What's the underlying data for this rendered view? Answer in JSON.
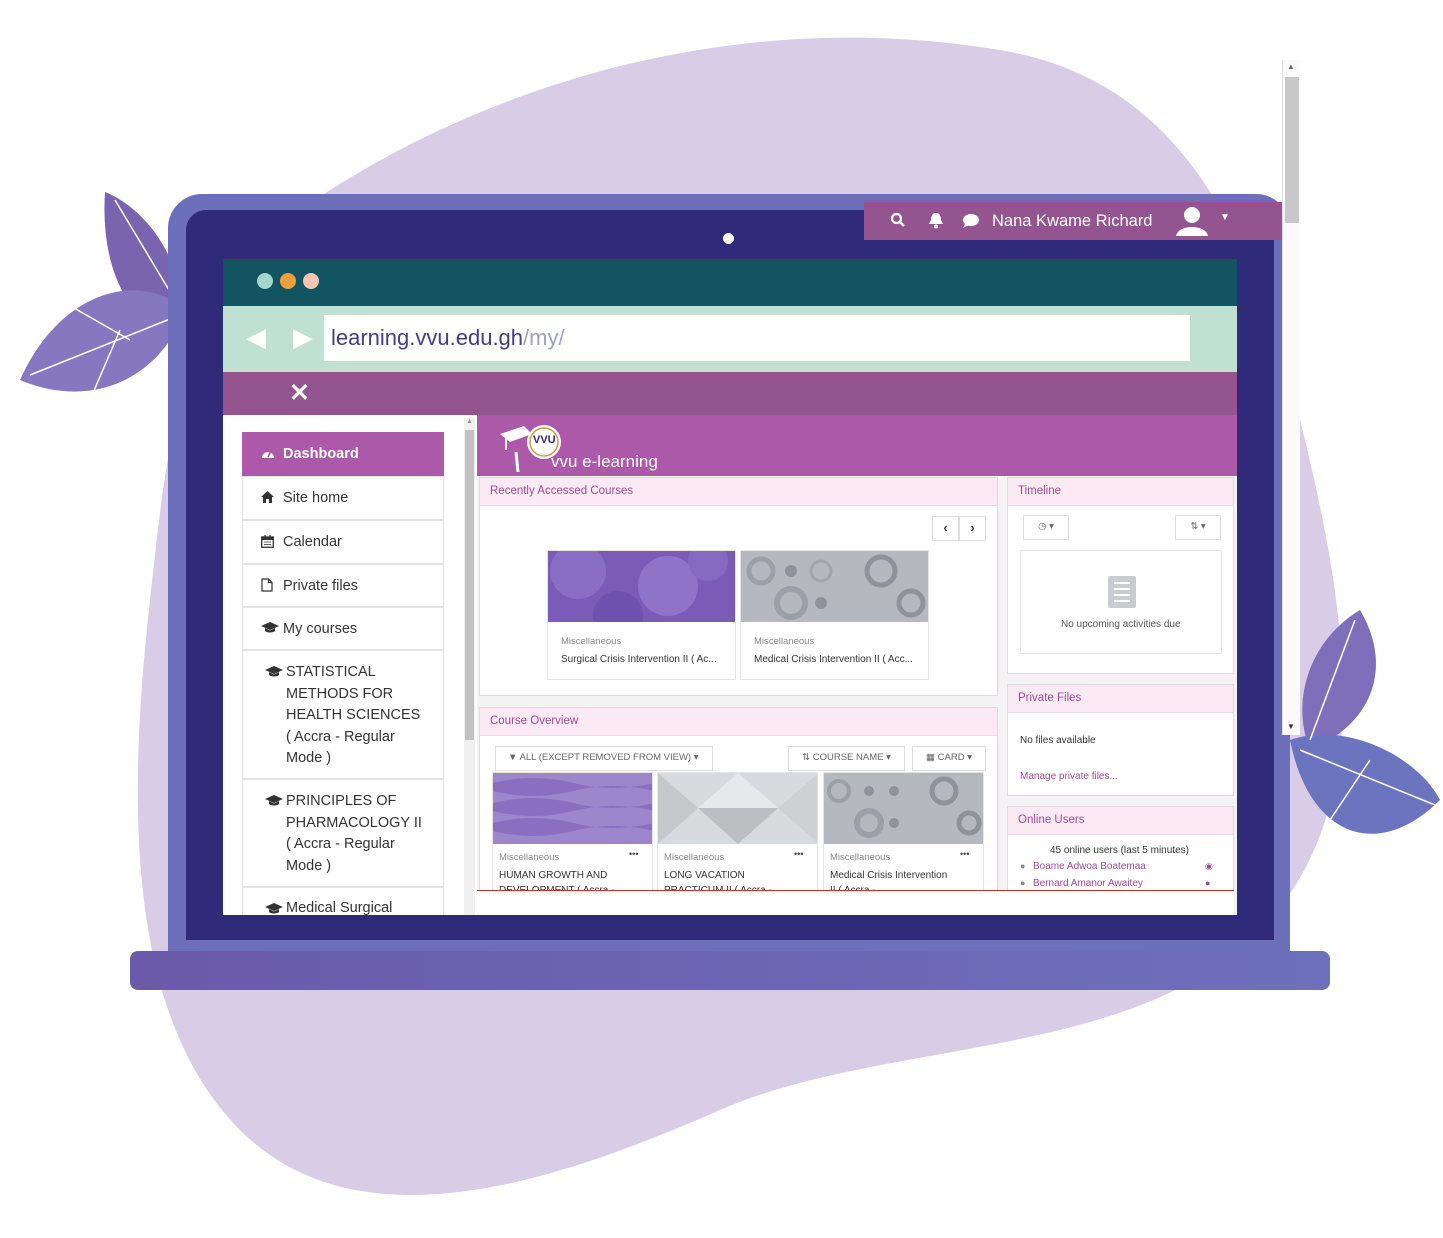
{
  "colors": {
    "blob": "#d9cce6",
    "laptop": "#6e6fbb",
    "bezel": "#2f2a7a",
    "teal": "#125561",
    "mint": "#bfe0d3",
    "plum": "#93548f",
    "accent": "#ab59a8"
  },
  "browser": {
    "url_host": "learning.vvu.edu.gh",
    "url_path": "/my/",
    "back_icon": "chevron-left-icon",
    "forward_icon": "chevron-right-icon",
    "close_icon": "close-icon"
  },
  "userbar": {
    "user_name": "Nana Kwame Richard",
    "icons": [
      "search-icon",
      "bell-icon",
      "chat-icon",
      "user-avatar-icon",
      "caret-down-icon"
    ]
  },
  "sidebar": {
    "items": [
      {
        "label": "Dashboard",
        "icon": "dashboard-icon",
        "active": true
      },
      {
        "label": "Site home",
        "icon": "home-icon"
      },
      {
        "label": "Calendar",
        "icon": "calendar-icon"
      },
      {
        "label": "Private files",
        "icon": "file-icon"
      },
      {
        "label": "My courses",
        "icon": "graduation-cap-icon"
      },
      {
        "label": "STATISTICAL METHODS FOR HEALTH SCIENCES ( Accra - Regular Mode )",
        "lines": [
          "STATISTICAL",
          "METHODS FOR",
          "HEALTH SCIENCES",
          "( Accra - Regular",
          "Mode )"
        ],
        "icon": "graduation-cap-icon"
      },
      {
        "label": "PRINCIPLES OF PHARMACOLOGY II ( Accra - Regular Mode )",
        "lines": [
          "PRINCIPLES OF",
          "PHARMACOLOGY II",
          "( Accra - Regular",
          "Mode )"
        ],
        "icon": "graduation-cap-icon"
      },
      {
        "label": "Medical Surgical",
        "icon": "graduation-cap-icon"
      }
    ]
  },
  "site": {
    "logo_text": "VVU",
    "brand": "vvu e-learning"
  },
  "recent": {
    "title": "Recently Accessed Courses",
    "courses": [
      {
        "category": "Miscellaneous",
        "name": "Surgical Crisis Intervention II ( Ac..."
      },
      {
        "category": "Miscellaneous",
        "name": "Medical Crisis Intervention II ( Acc..."
      }
    ]
  },
  "timeline": {
    "title": "Timeline",
    "empty": "No upcoming activities due"
  },
  "private_files": {
    "title": "Private Files",
    "empty": "No files available",
    "manage_link": "Manage private files..."
  },
  "overview": {
    "title": "Course Overview",
    "filter": "ALL (EXCEPT REMOVED FROM VIEW)",
    "sort": "COURSE NAME",
    "view": "CARD",
    "courses": [
      {
        "category": "Miscellaneous",
        "line1": "HUMAN GROWTH AND",
        "line2": "DEVELOPMENT ( Accra -"
      },
      {
        "category": "Miscellaneous",
        "line1": "LONG VACATION",
        "line2": "PRACTICUM II ( Accra -"
      },
      {
        "category": "Miscellaneous",
        "line1": "Medical Crisis Intervention",
        "line2": "II ( Accra -"
      }
    ],
    "menu_glyph": "•••"
  },
  "online": {
    "title": "Online Users",
    "summary": "45 online users (last 5 minutes)",
    "users": [
      "Boame Adwoa Boatemaa",
      "Bernard Amanor Awaitey"
    ]
  }
}
